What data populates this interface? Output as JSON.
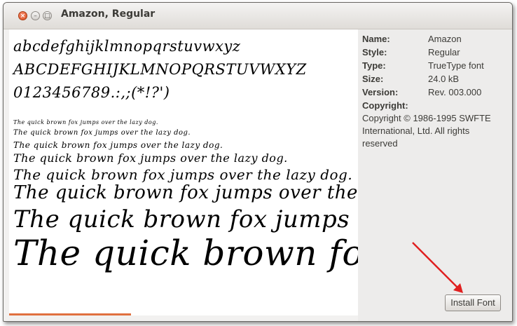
{
  "window": {
    "title": "Amazon, Regular",
    "close_glyph": "×",
    "min_glyph": "–",
    "max_glyph": "□"
  },
  "preview": {
    "lowercase": "abcdefghijklmnopqrstuvwxyz",
    "uppercase": "ABCDEFGHIJKLMNOPQRSTUVWXYZ",
    "digits": "0123456789.:,;(*!?')",
    "sample": "The quick brown fox jumps over the lazy dog.",
    "progress_percent": 35
  },
  "info": {
    "name_label": "Name:",
    "name_value": "Amazon",
    "style_label": "Style:",
    "style_value": "Regular",
    "type_label": "Type:",
    "type_value": "TrueType font",
    "size_label": "Size:",
    "size_value": "24.0 kB",
    "version_label": "Version:",
    "version_value": "Rev. 003.000",
    "copyright_label": "Copyright:",
    "copyright_value": "Copyright © 1986-1995 SWFTE International, Ltd. All rights reserved"
  },
  "actions": {
    "install_label": "Install Font"
  },
  "colors": {
    "accent_progress": "#e0703f",
    "annotation_arrow": "#e02020"
  }
}
